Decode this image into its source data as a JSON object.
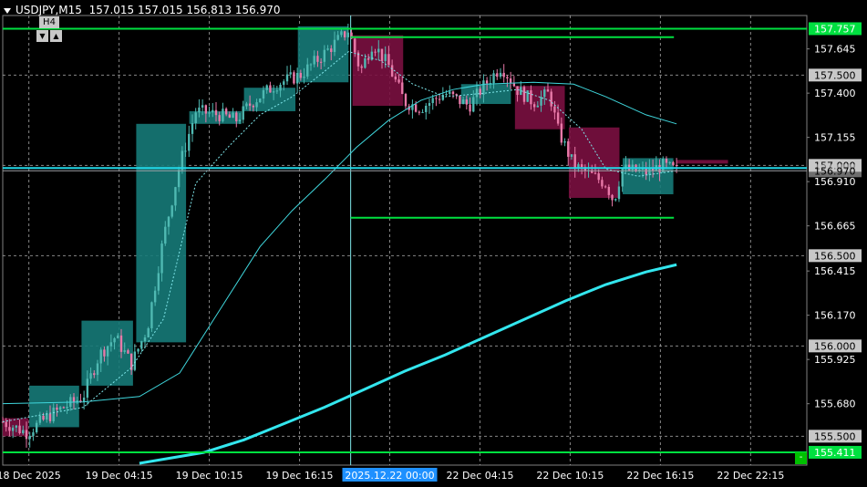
{
  "header": {
    "symbol": "USDJPY,M15",
    "ohlc": "157.015 157.015 156.813 156.970"
  },
  "timeframe_panel": {
    "label": "H4",
    "down_icon": "triangle-down-icon",
    "up_icon": "triangle-up-icon"
  },
  "corner_button": {
    "label": "-"
  },
  "colors": {
    "background": "#000000",
    "grid": "#c0c0c0",
    "bull_candle": "#4fb9b2",
    "bear_candle": "#e879a8",
    "htf_bull": "#167a78",
    "htf_bear": "#7a1040",
    "ma_fast": "#7fe6ea",
    "ma_mid": "#3fd6dc",
    "ma_slow": "#33e6ee",
    "hline": "#00e040",
    "cyan_line": "#22d8e8"
  },
  "chart_data": {
    "type": "candlestick",
    "y_range": [
      155.34,
      157.83
    ],
    "y_ticks": [
      "157.645",
      "157.400",
      "157.155",
      "156.910",
      "156.665",
      "156.415",
      "156.170",
      "155.925",
      "155.680"
    ],
    "x_ticks": [
      "18 Dec 2025",
      "19 Dec 04:15",
      "19 Dec 10:15",
      "19 Dec 16:15",
      "2025.12.22 00:00",
      "22 Dec 04:15",
      "22 Dec 10:15",
      "22 Dec 16:15",
      "22 Dec 22:15"
    ],
    "crosshair_time_label": "2025.12.22 00:00",
    "price_labels": [
      {
        "price": 157.757,
        "text": "157.757",
        "style": "green"
      },
      {
        "price": 157.5,
        "text": "157.500",
        "style": "gray"
      },
      {
        "price": 157.0,
        "text": "157.000",
        "style": "gray"
      },
      {
        "price": 156.97,
        "text": "156.970",
        "style": "gray-dim"
      },
      {
        "price": 156.5,
        "text": "156.500",
        "style": "gray"
      },
      {
        "price": 156.0,
        "text": "156.000",
        "style": "gray"
      },
      {
        "price": 155.5,
        "text": "155.500",
        "style": "gray"
      },
      {
        "price": 155.411,
        "text": "155.411",
        "style": "green"
      }
    ],
    "horizontal_dashed_levels": [
      157.5,
      157.0,
      156.5,
      156.0,
      155.5
    ],
    "bid_line": 156.97,
    "cyan_level": 156.985,
    "green_levels_full": [
      157.757,
      155.411
    ],
    "green_levels_session": [
      {
        "price": 157.71,
        "from": 0.4327,
        "to": 0.8347
      },
      {
        "price": 156.71,
        "from": 0.4327,
        "to": 0.8347
      }
    ],
    "bars_count": 200,
    "session_divider": 0.4327,
    "last_bar": 0.838,
    "htf_blocks": [
      {
        "from": 0.0,
        "to": 0.032,
        "open": 155.6,
        "close": 155.5,
        "high": 155.65,
        "low": 155.38
      },
      {
        "from": 0.033,
        "to": 0.095,
        "open": 155.55,
        "close": 155.78,
        "high": 155.85,
        "low": 155.4
      },
      {
        "from": 0.098,
        "to": 0.162,
        "open": 155.78,
        "close": 156.14,
        "high": 156.2,
        "low": 155.65
      },
      {
        "from": 0.166,
        "to": 0.228,
        "open": 156.02,
        "close": 157.23,
        "high": 157.3,
        "low": 155.9
      },
      {
        "from": 0.232,
        "to": 0.297,
        "open": 157.23,
        "close": 157.3,
        "high": 157.4,
        "low": 157.1
      },
      {
        "from": 0.3,
        "to": 0.364,
        "open": 157.3,
        "close": 157.43,
        "high": 157.6,
        "low": 157.0
      },
      {
        "from": 0.367,
        "to": 0.43,
        "open": 157.46,
        "close": 157.77,
        "high": 157.8,
        "low": 157.4
      },
      {
        "from": 0.435,
        "to": 0.498,
        "open": 157.72,
        "close": 157.33,
        "high": 157.73,
        "low": 157.26
      },
      {
        "from": 0.57,
        "to": 0.632,
        "open": 157.34,
        "close": 157.45,
        "high": 157.55,
        "low": 157.28
      },
      {
        "from": 0.637,
        "to": 0.699,
        "open": 157.44,
        "close": 157.2,
        "high": 157.46,
        "low": 157.0
      },
      {
        "from": 0.704,
        "to": 0.767,
        "open": 157.21,
        "close": 156.82,
        "high": 157.22,
        "low": 156.72
      },
      {
        "from": 0.771,
        "to": 0.834,
        "open": 156.84,
        "close": 157.04,
        "high": 157.07,
        "low": 156.85
      },
      {
        "from": 0.838,
        "to": 0.902,
        "open": 157.03,
        "close": 157.01,
        "high": 157.03,
        "low": 156.88
      }
    ],
    "price_path": [
      [
        0.0,
        155.58
      ],
      [
        0.03,
        155.52
      ],
      [
        0.06,
        155.62
      ],
      [
        0.1,
        155.72
      ],
      [
        0.12,
        155.95
      ],
      [
        0.14,
        156.05
      ],
      [
        0.16,
        155.9
      ],
      [
        0.18,
        156.1
      ],
      [
        0.2,
        156.6
      ],
      [
        0.22,
        157.0
      ],
      [
        0.24,
        157.3
      ],
      [
        0.27,
        157.28
      ],
      [
        0.29,
        157.25
      ],
      [
        0.31,
        157.35
      ],
      [
        0.34,
        157.45
      ],
      [
        0.37,
        157.5
      ],
      [
        0.4,
        157.62
      ],
      [
        0.43,
        157.75
      ],
      [
        0.445,
        157.52
      ],
      [
        0.46,
        157.68
      ],
      [
        0.48,
        157.55
      ],
      [
        0.5,
        157.35
      ],
      [
        0.52,
        157.32
      ],
      [
        0.55,
        157.4
      ],
      [
        0.58,
        157.33
      ],
      [
        0.6,
        157.45
      ],
      [
        0.62,
        157.55
      ],
      [
        0.64,
        157.42
      ],
      [
        0.66,
        157.35
      ],
      [
        0.68,
        157.4
      ],
      [
        0.69,
        157.2
      ],
      [
        0.71,
        157.0
      ],
      [
        0.73,
        156.95
      ],
      [
        0.75,
        156.9
      ],
      [
        0.76,
        156.8
      ],
      [
        0.77,
        156.98
      ],
      [
        0.8,
        156.96
      ],
      [
        0.82,
        157.0
      ],
      [
        0.838,
        156.97
      ]
    ],
    "ma_fast": [
      [
        0.0,
        155.58
      ],
      [
        0.1,
        155.66
      ],
      [
        0.16,
        155.88
      ],
      [
        0.2,
        156.15
      ],
      [
        0.24,
        156.9
      ],
      [
        0.28,
        157.1
      ],
      [
        0.32,
        157.28
      ],
      [
        0.36,
        157.38
      ],
      [
        0.4,
        157.52
      ],
      [
        0.43,
        157.63
      ],
      [
        0.47,
        157.58
      ],
      [
        0.51,
        157.45
      ],
      [
        0.55,
        157.38
      ],
      [
        0.6,
        157.4
      ],
      [
        0.64,
        157.42
      ],
      [
        0.68,
        157.36
      ],
      [
        0.72,
        157.2
      ],
      [
        0.75,
        156.98
      ],
      [
        0.79,
        156.94
      ],
      [
        0.838,
        156.97
      ]
    ],
    "ma_mid": [
      [
        0.0,
        155.68
      ],
      [
        0.1,
        155.69
      ],
      [
        0.17,
        155.72
      ],
      [
        0.22,
        155.85
      ],
      [
        0.27,
        156.2
      ],
      [
        0.32,
        156.55
      ],
      [
        0.36,
        156.75
      ],
      [
        0.4,
        156.92
      ],
      [
        0.44,
        157.1
      ],
      [
        0.48,
        157.25
      ],
      [
        0.52,
        157.36
      ],
      [
        0.56,
        157.42
      ],
      [
        0.6,
        157.45
      ],
      [
        0.66,
        157.46
      ],
      [
        0.71,
        157.45
      ],
      [
        0.75,
        157.38
      ],
      [
        0.8,
        157.28
      ],
      [
        0.838,
        157.23
      ]
    ],
    "ma_slow": [
      [
        0.17,
        155.35
      ],
      [
        0.25,
        155.41
      ],
      [
        0.3,
        155.48
      ],
      [
        0.35,
        155.57
      ],
      [
        0.4,
        155.66
      ],
      [
        0.45,
        155.76
      ],
      [
        0.5,
        155.86
      ],
      [
        0.55,
        155.95
      ],
      [
        0.6,
        156.05
      ],
      [
        0.65,
        156.15
      ],
      [
        0.7,
        156.25
      ],
      [
        0.75,
        156.34
      ],
      [
        0.8,
        156.41
      ],
      [
        0.838,
        156.45
      ]
    ]
  }
}
